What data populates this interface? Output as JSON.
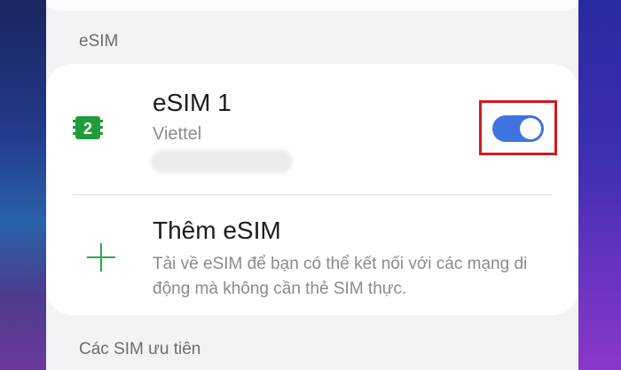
{
  "sections": {
    "esim_header": "eSIM",
    "preferred_header": "Các SIM ưu tiên"
  },
  "esim1": {
    "title": "eSIM 1",
    "carrier": "Viettel",
    "sim_badge": "2",
    "toggle_on": true
  },
  "add_esim": {
    "title": "Thêm eSIM",
    "description": "Tải về eSIM để bạn có thể kết nối với các mạng di động mà không cần thẻ SIM thực."
  },
  "colors": {
    "accent_blue": "#3e74e0",
    "sim_green": "#1f9d3c",
    "plus_green": "#2aaa4e",
    "highlight_red": "#d4181f"
  },
  "icons": {
    "sim": "sim-card-icon",
    "add": "plus-icon"
  }
}
